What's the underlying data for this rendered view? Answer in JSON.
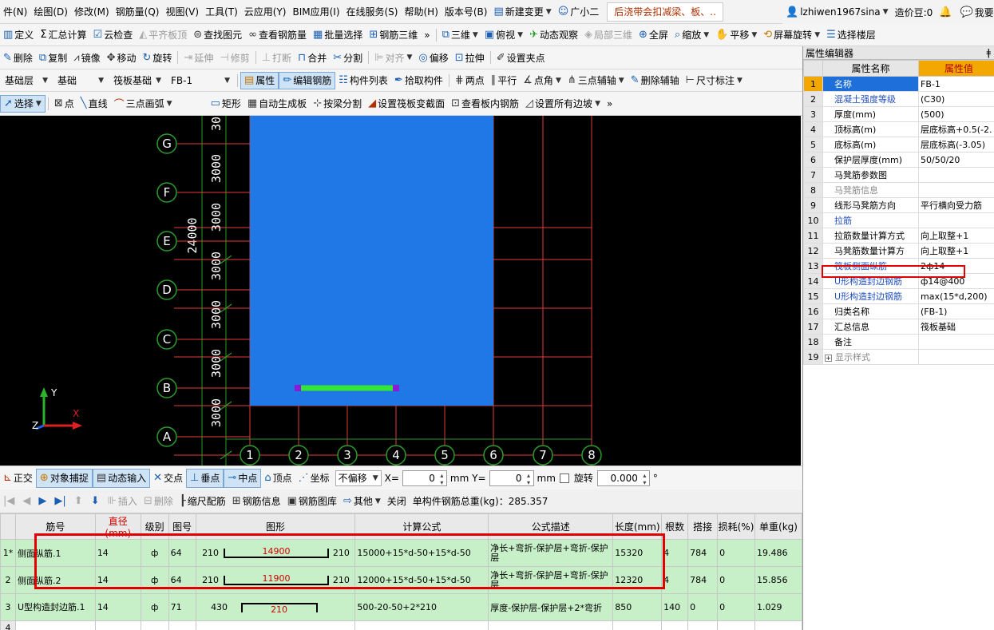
{
  "menubar": {
    "items": [
      "件(N)",
      "绘图(D)",
      "修改(M)",
      "钢筋量(Q)",
      "视图(V)",
      "工具(T)",
      "云应用(Y)",
      "BIM应用(I)",
      "在线服务(S)",
      "帮助(H)",
      "版本号(B)"
    ],
    "new_change": "新建变更",
    "assistant": "广小二",
    "doc_tab": "后浇带会扣减梁、板、.."
  },
  "topright": {
    "user": "lzhiwen1967sina",
    "coins": "造价豆:0",
    "suggest": "我要建"
  },
  "toolbar1": {
    "items": [
      "定义",
      "汇总计算",
      "云检查",
      "平齐板顶",
      "查找图元",
      "查看钢筋量",
      "批量选择",
      "钢筋三维",
      "三维",
      "俯视",
      "动态观察",
      "局部三维",
      "全屏",
      "缩放",
      "平移",
      "屏幕旋转",
      "选择楼层"
    ],
    "more": "»"
  },
  "toolbar2": {
    "items": [
      "删除",
      "复制",
      "镜像",
      "移动",
      "旋转",
      "延伸",
      "修剪",
      "打断",
      "合并",
      "分割",
      "对齐",
      "偏移",
      "拉伸",
      "设置夹点"
    ]
  },
  "toolbar3": {
    "layer": "基础层",
    "layer_sub": "基础",
    "type": "筏板基础",
    "comp": "FB-1",
    "items": [
      "属性",
      "编辑钢筋",
      "构件列表",
      "拾取构件",
      "两点",
      "平行",
      "点角",
      "三点辅轴",
      "删除辅轴",
      "尺寸标注"
    ]
  },
  "toolbar4": {
    "items": [
      "选择",
      "点",
      "直线",
      "三点画弧",
      "矩形",
      "自动生成板",
      "按梁分割",
      "设置筏板变截面",
      "查看板内钢筋",
      "设置所有边坡"
    ],
    "more": "»"
  },
  "canvas": {
    "row_axes": [
      "G",
      "F",
      "E",
      "D",
      "C",
      "B",
      "A"
    ],
    "col_axes": [
      "1",
      "2",
      "3",
      "4",
      "5",
      "6",
      "7",
      "8"
    ],
    "spacing_labels": [
      "30",
      "3000",
      "3000",
      "3000",
      "3000",
      "3000",
      "3000"
    ],
    "total_label": "24000",
    "ucs": {
      "y": "Y",
      "x": "X",
      "z": "Z"
    },
    "colors": {
      "slab": "#1f78e6",
      "grid": "#e83a3a",
      "dim": "#2a9d2a",
      "beam": "#33e633",
      "beam_end": "#8a1ad6"
    }
  },
  "statusbar": {
    "items": [
      "正交",
      "对象捕捉",
      "动态输入",
      "交点",
      "垂点",
      "中点",
      "顶点",
      "坐标"
    ],
    "offset_mode": "不偏移",
    "x_label": "X=",
    "x_value": "0",
    "y_label": "mm Y=",
    "y_value": "0",
    "unit": "mm",
    "rotate_label": "旋转",
    "rotate_value": "0.000",
    "degree": "°"
  },
  "rebarbar": {
    "items": [
      "插入",
      "删除",
      "缩尺配筋",
      "钢筋信息",
      "钢筋图库",
      "其他",
      "关闭"
    ],
    "total": "单构件钢筋总重(kg)：285.357"
  },
  "rebar_grid": {
    "headers": [
      "筋号",
      "直径(mm)",
      "级别",
      "图号",
      "图形",
      "计算公式",
      "公式描述",
      "长度(mm)",
      "根数",
      "搭接",
      "损耗(%)",
      "单重(kg)"
    ],
    "rows": [
      {
        "idx": "1*",
        "name": "侧面纵筋.1",
        "dia": "14",
        "grade": "ф",
        "fig": "64",
        "shape_l": "210",
        "shape_m": "14900",
        "shape_r": "210",
        "formula": "15000+15*d-50+15*d-50",
        "desc": "净长+弯折-保护层+弯折-保护层",
        "len": "15320",
        "count": "4",
        "lap": "784",
        "loss": "0",
        "weight": "19.486"
      },
      {
        "idx": "2",
        "name": "侧面纵筋.2",
        "dia": "14",
        "grade": "ф",
        "fig": "64",
        "shape_l": "210",
        "shape_m": "11900",
        "shape_r": "210",
        "formula": "12000+15*d-50+15*d-50",
        "desc": "净长+弯折-保护层+弯折-保护层",
        "len": "12320",
        "count": "4",
        "lap": "784",
        "loss": "0",
        "weight": "15.856"
      },
      {
        "idx": "3",
        "name": "U型构造封边筋.1",
        "dia": "14",
        "grade": "ф",
        "fig": "71",
        "shape_l": "430",
        "shape_m": "210",
        "shape_r": "",
        "formula": "500-20-50+2*210",
        "desc": "厚度-保护层-保护层+2*弯折",
        "len": "850",
        "count": "140",
        "lap": "0",
        "loss": "0",
        "weight": "1.029"
      },
      {
        "idx": "4",
        "name": "",
        "dia": "",
        "grade": "",
        "fig": "",
        "shape_l": "",
        "shape_m": "",
        "shape_r": "",
        "formula": "",
        "desc": "",
        "len": "",
        "count": "",
        "lap": "",
        "loss": "",
        "weight": ""
      }
    ]
  },
  "prop_editor": {
    "title": "属性编辑器",
    "pin": "ǂ",
    "col_name": "属性名称",
    "col_value": "属性值",
    "rows": [
      {
        "n": "1",
        "k": "名称",
        "v": "FB-1",
        "c": ""
      },
      {
        "n": "2",
        "k": "混凝土强度等级",
        "v": "(C30)",
        "c": "blue"
      },
      {
        "n": "3",
        "k": "厚度(mm)",
        "v": "(500)",
        "c": ""
      },
      {
        "n": "4",
        "k": "顶标高(m)",
        "v": "层底标高+0.5(-2.",
        "c": ""
      },
      {
        "n": "5",
        "k": "底标高(m)",
        "v": "层底标高(-3.05)",
        "c": ""
      },
      {
        "n": "6",
        "k": "保护层厚度(mm)",
        "v": "50/50/20",
        "c": ""
      },
      {
        "n": "7",
        "k": "马凳筋参数图",
        "v": "",
        "c": ""
      },
      {
        "n": "8",
        "k": "马凳筋信息",
        "v": "",
        "c": "gray"
      },
      {
        "n": "9",
        "k": "线形马凳筋方向",
        "v": "平行横向受力筋",
        "c": ""
      },
      {
        "n": "10",
        "k": "拉筋",
        "v": "",
        "c": "blue"
      },
      {
        "n": "11",
        "k": "拉筋数量计算方式",
        "v": "向上取整+1",
        "c": ""
      },
      {
        "n": "12",
        "k": "马凳筋数量计算方",
        "v": "向上取整+1",
        "c": ""
      },
      {
        "n": "13",
        "k": "筏板侧面纵筋",
        "v": "2ф14",
        "c": "blue"
      },
      {
        "n": "14",
        "k": "U形构造封边钢筋",
        "v": "ф14@400",
        "c": "blue"
      },
      {
        "n": "15",
        "k": "U形构造封边钢筋",
        "v": "max(15*d,200)",
        "c": "blue"
      },
      {
        "n": "16",
        "k": "归类名称",
        "v": "(FB-1)",
        "c": ""
      },
      {
        "n": "17",
        "k": "汇总信息",
        "v": "筏板基础",
        "c": ""
      },
      {
        "n": "18",
        "k": "备注",
        "v": "",
        "c": ""
      },
      {
        "n": "19",
        "k": "显示样式",
        "v": "",
        "c": "gray"
      }
    ]
  }
}
